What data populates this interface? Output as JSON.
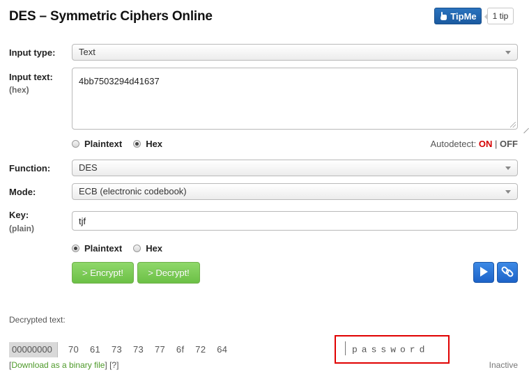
{
  "header": {
    "title": "DES – Symmetric Ciphers Online",
    "tipme_label": "TipMe",
    "tips_count": "1 tip"
  },
  "form": {
    "input_type": {
      "label": "Input type:",
      "value": "Text"
    },
    "input_text": {
      "label": "Input text:",
      "sublabel": "(hex)",
      "value": "4bb7503294d41637",
      "format_options": [
        "Plaintext",
        "Hex"
      ],
      "selected_format": "Hex"
    },
    "autodetect": {
      "label": "Autodetect:",
      "on": "ON",
      "separator": "|",
      "off": "OFF",
      "state": "ON"
    },
    "function": {
      "label": "Function:",
      "value": "DES"
    },
    "mode": {
      "label": "Mode:",
      "value": "ECB (electronic codebook)"
    },
    "key": {
      "label": "Key:",
      "sublabel": "(plain)",
      "value": "tjf",
      "format_options": [
        "Plaintext",
        "Hex"
      ],
      "selected_format": "Plaintext"
    },
    "encrypt_label": "> Encrypt!",
    "decrypt_label": "> Decrypt!"
  },
  "output": {
    "label": "Decrypted text:",
    "offset": "00000000",
    "hex_bytes": [
      "70",
      "61",
      "73",
      "73",
      "77",
      "6f",
      "72",
      "64"
    ],
    "ascii": "password",
    "download_link": "Download as a binary file",
    "help_link": "[?]",
    "status": "Inactive"
  },
  "colors": {
    "accent_green": "#6cc046",
    "accent_blue": "#1d63c8",
    "autodetect_on": "#d50000",
    "highlight_box": "#e00000"
  },
  "icons": {
    "play": "play-icon",
    "link": "link-icon",
    "tipme": "tipme-hand-icon",
    "dropdown": "chevron-down-icon"
  }
}
